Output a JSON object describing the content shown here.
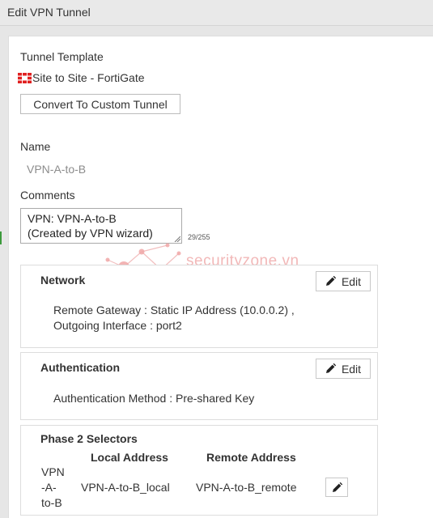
{
  "window": {
    "title": "Edit VPN Tunnel"
  },
  "tunnel_template": {
    "label": "Tunnel Template",
    "value": "Site to Site - FortiGate",
    "icon": "fortigate-logo-icon",
    "convert_button": "Convert To Custom Tunnel"
  },
  "name": {
    "label": "Name",
    "value": "VPN-A-to-B"
  },
  "comments": {
    "label": "Comments",
    "line1": "VPN: VPN-A-to-B",
    "line2": "(Created by VPN wizard)",
    "counter": "29/255"
  },
  "watermark": {
    "text": "securityzone.vn"
  },
  "network": {
    "title": "Network",
    "edit_label": "Edit",
    "line1": "Remote Gateway : Static IP Address (10.0.0.2) ,",
    "line2": "Outgoing Interface : port2"
  },
  "authentication": {
    "title": "Authentication",
    "edit_label": "Edit",
    "line1": "Authentication Method : Pre-shared Key"
  },
  "phase2": {
    "title": "Phase 2 Selectors",
    "columns": {
      "local": "Local Address",
      "remote": "Remote Address"
    },
    "row": {
      "name_line1": "VPN",
      "name_line2": "-A-",
      "name_line3": "to-B",
      "local": "VPN-A-to-B_local",
      "remote": "VPN-A-to-B_remote"
    }
  },
  "colors": {
    "fortigate_red": "#e02020",
    "name_value_gray": "#8c8c8c",
    "watermark": "#f2b8b8"
  }
}
